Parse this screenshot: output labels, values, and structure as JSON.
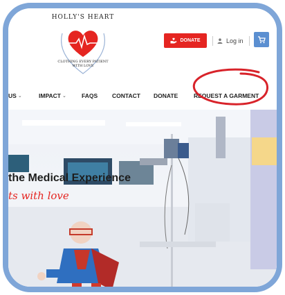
{
  "logo": {
    "name": "HOLLY'S HEART",
    "tagline_line1": "CLOTHING EVERY PATIENT",
    "tagline_line2": "WITH LOVE"
  },
  "header": {
    "donate_label": "DONATE",
    "login_label": "Log in"
  },
  "nav": {
    "items": [
      {
        "label": "US",
        "has_dropdown": true
      },
      {
        "label": "IMPACT",
        "has_dropdown": true
      },
      {
        "label": "FAQS",
        "has_dropdown": false
      },
      {
        "label": "CONTACT",
        "has_dropdown": false
      },
      {
        "label": "DONATE",
        "has_dropdown": false
      },
      {
        "label": "REQUEST A GARMENT",
        "has_dropdown": false
      }
    ]
  },
  "hero": {
    "title": "the Medical Experience",
    "subtitle": "ts with love"
  },
  "colors": {
    "accent_red": "#e52521",
    "cart_blue": "#5b8fd1",
    "frame_blue": "#7fa6d8"
  }
}
